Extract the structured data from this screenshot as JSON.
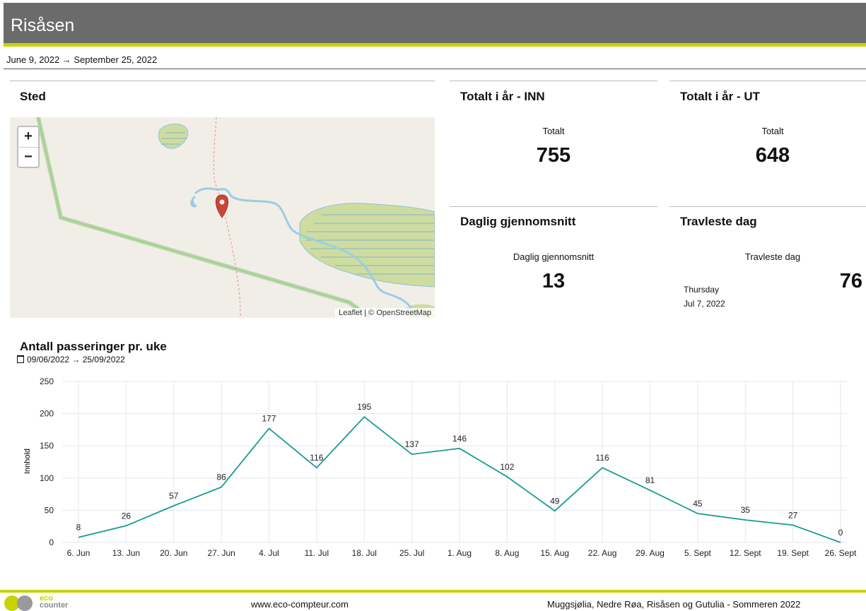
{
  "header": {
    "title": "Risåsen",
    "date_range": "June 9, 2022 → September 25, 2022"
  },
  "location": {
    "heading": "Sted",
    "zoom_in": "+",
    "zoom_out": "−",
    "attribution": "Leaflet | © OpenStreetMap"
  },
  "kpi": {
    "total_in": {
      "heading": "Totalt i år - INN",
      "label": "Totalt",
      "value": "755"
    },
    "total_out": {
      "heading": "Totalt i år - UT",
      "label": "Totalt",
      "value": "648"
    },
    "daily_avg": {
      "heading": "Daglig gjennomsnitt",
      "label": "Daglig gjennomsnitt",
      "value": "13"
    },
    "busiest": {
      "heading": "Travleste dag",
      "label": "Travleste dag",
      "weekday": "Thursday",
      "date": "Jul 7, 2022",
      "value": "76"
    }
  },
  "chart_section": {
    "title": "Antall passeringer pr. uke",
    "date_range": "09/06/2022 → 25/09/2022"
  },
  "chart_data": {
    "type": "line",
    "title": "Antall passeringer pr. uke",
    "ylabel": "Innhold",
    "xlabel": "",
    "categories": [
      "6. Jun",
      "13. Jun",
      "20. Jun",
      "27. Jun",
      "4. Jul",
      "11. Jul",
      "18. Jul",
      "25. Jul",
      "1. Aug",
      "8. Aug",
      "15. Aug",
      "22. Aug",
      "29. Aug",
      "5. Sept",
      "12. Sept",
      "19. Sept",
      "26. Sept"
    ],
    "values": [
      8,
      26,
      57,
      86,
      177,
      116,
      195,
      137,
      146,
      102,
      49,
      116,
      81,
      45,
      35,
      27,
      0
    ],
    "ylim": [
      0,
      250
    ],
    "yticks": [
      0,
      50,
      100,
      150,
      200,
      250
    ],
    "grid": true,
    "line_color": "#1a9a96"
  },
  "footer": {
    "logo_top": "eco",
    "logo_bottom": "counter",
    "url": "www.eco-compteur.com",
    "caption": "Muggsjølia, Nedre Røa, Risåsen og Gutulia - Sommeren 2022"
  }
}
